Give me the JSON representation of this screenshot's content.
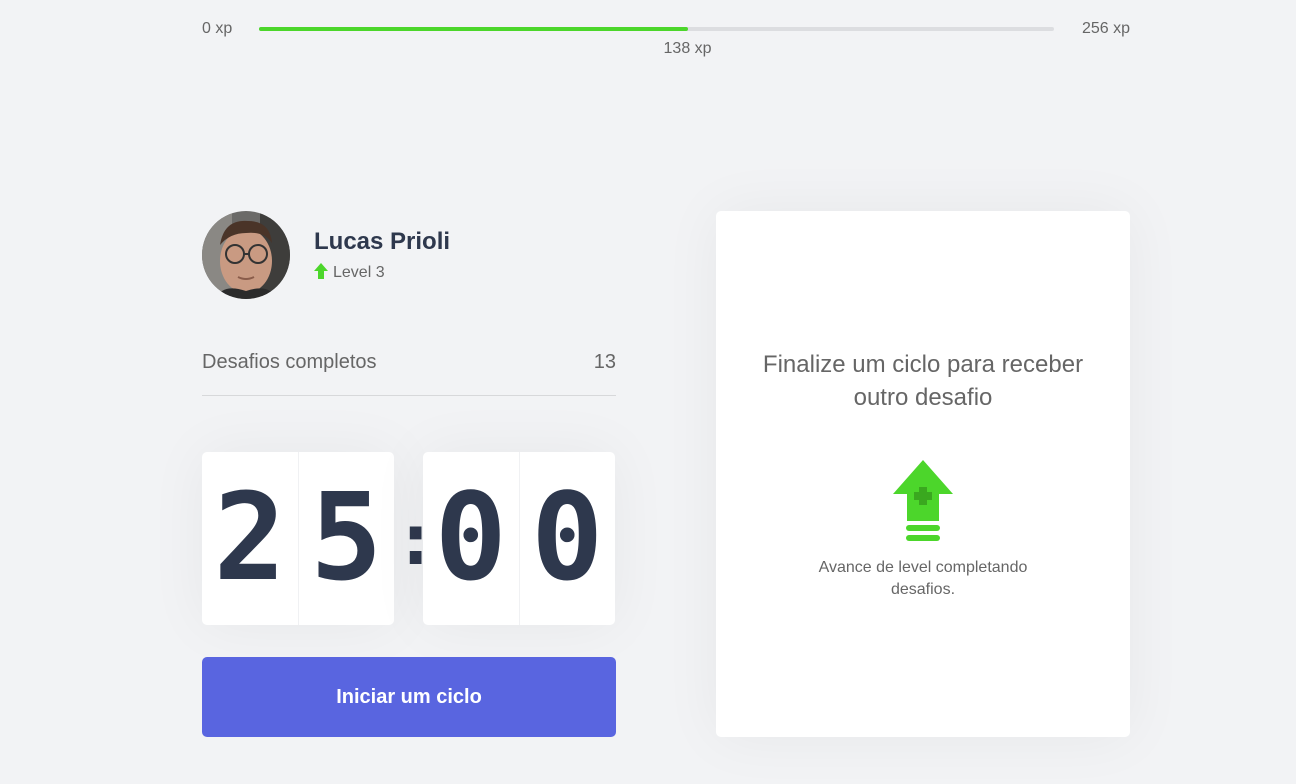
{
  "xp": {
    "min_label": "0 xp",
    "max_label": "256 xp",
    "current_label": "138 xp",
    "current": 138,
    "max": 256,
    "fill_color": "#4cd62b"
  },
  "profile": {
    "name": "Lucas Prioli",
    "level_label": "Level 3",
    "level_icon": "level-up-arrow-icon"
  },
  "challenges": {
    "label": "Desafios completos",
    "count": "13"
  },
  "countdown": {
    "minute_left": "2",
    "minute_right": "5",
    "separator": ":",
    "second_left": "0",
    "second_right": "0"
  },
  "start_button": {
    "label": "Iniciar um ciclo",
    "color": "#5965e0"
  },
  "challenge_box": {
    "title": "Finalize um ciclo para receber outro desafio",
    "icon": "level-up-icon",
    "description": "Avance de level completando desafios."
  },
  "colors": {
    "accent_green": "#4cd62b",
    "title_dark": "#2e384d",
    "text": "#666666",
    "background": "#f2f3f5"
  }
}
